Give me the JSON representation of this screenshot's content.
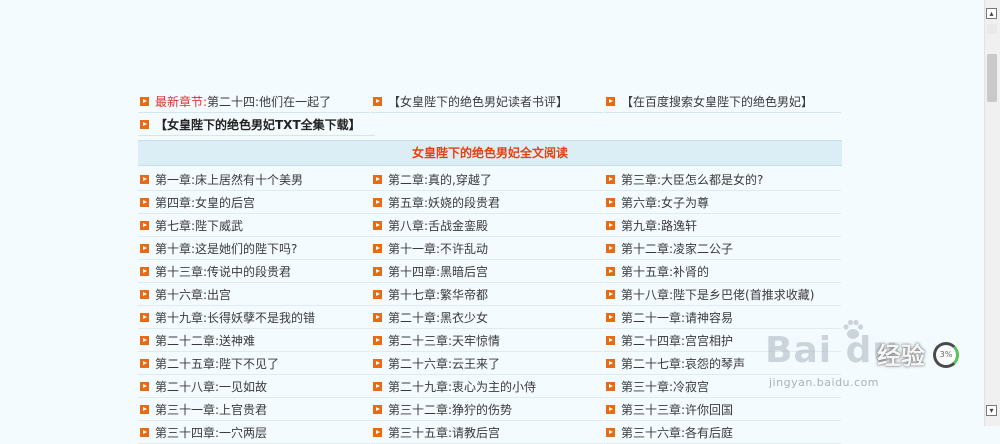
{
  "top_links": {
    "latest_label": "最新章节:",
    "latest_chapter": "第二十四:他们在一起了",
    "reviews_link": "【女皇陛下的绝色男妃读者书评】",
    "search_link": "【在百度搜索女皇陛下的绝色男妃】",
    "download_link": "【女皇陛下的绝色男妃TXT全集下载】"
  },
  "section_title": "女皇陛下的绝色男妃全文阅读",
  "chapters": [
    [
      "第一章:床上居然有十个美男",
      "第二章:真的,穿越了",
      "第三章:大臣怎么都是女的?"
    ],
    [
      "第四章:女皇的后宫",
      "第五章:妖娆的段贵君",
      "第六章:女子为尊"
    ],
    [
      "第七章:陛下威武",
      "第八章:舌战金銮殿",
      "第九章:路逸轩"
    ],
    [
      "第十章:这是她们的陛下吗?",
      "第十一章:不许乱动",
      "第十二章:凌家二公子"
    ],
    [
      "第十三章:传说中的段贵君",
      "第十四章:黑暗后宫",
      "第十五章:补肾的"
    ],
    [
      "第十六章:出宫",
      "第十七章:繁华帝都",
      "第十八章:陛下是乡巴佬(首推求收藏)"
    ],
    [
      "第十九章:长得妖孽不是我的错",
      "第二十章:黑衣少女",
      "第二十一章:请神容易"
    ],
    [
      "第二十二章:送神难",
      "第二十三章:天牢惊情",
      "第二十四章:宫宫相护"
    ],
    [
      "第二十五章:陛下不见了",
      "第二十六章:云王来了",
      "第二十七章:哀怨的琴声"
    ],
    [
      "第二十八章:一见如故",
      "第二十九章:衷心为主的小侍",
      "第三十章:冷寂宫"
    ],
    [
      "第三十一章:上官贵君",
      "第三十二章:狰狞的伤势",
      "第三十三章:许你回国"
    ],
    [
      "第三十四章:一穴两层",
      "第三十五章:请教后宫",
      "第三十六章:各有后庭"
    ]
  ],
  "watermark": {
    "brand": "Bai du",
    "badge": "经验",
    "url": "jingyan.baidu.com",
    "progress": "3%"
  },
  "colors": {
    "bullet": "#e86a12",
    "section_title": "#e8400c",
    "latest_label": "#e03030",
    "section_bg": "#dceef5",
    "page_bg": "#f4fbff"
  }
}
